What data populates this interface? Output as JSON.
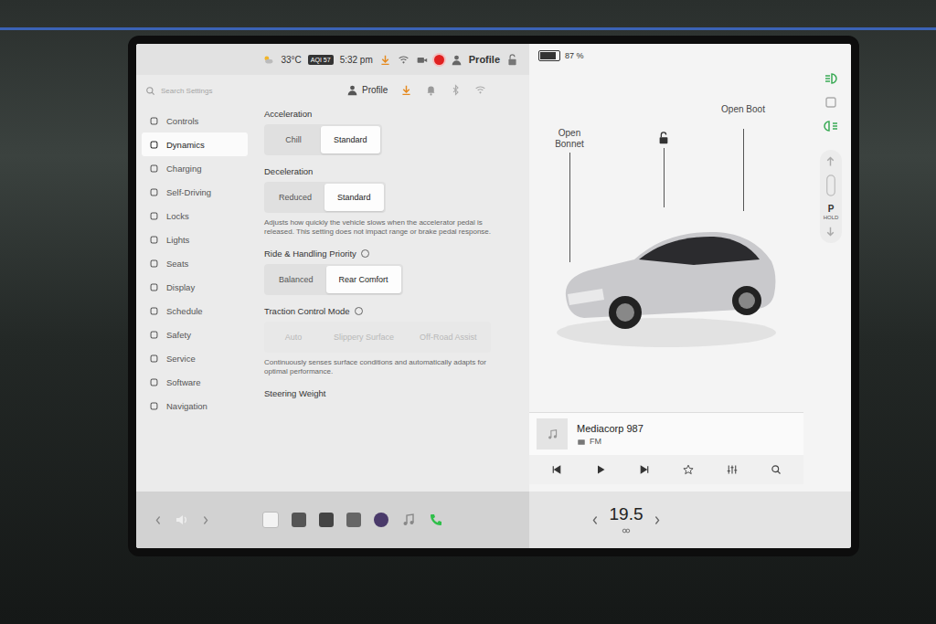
{
  "status_bar": {
    "temperature": "33°C",
    "aqi": "AQI 57",
    "time": "5:32 pm",
    "profile": "Profile",
    "recording": true,
    "battery": "87 %",
    "battery_level": 0.87
  },
  "search": {
    "placeholder": "Search Settings"
  },
  "header": {
    "profile": "Profile"
  },
  "sidebar": {
    "items": [
      {
        "label": "Controls",
        "selected": false
      },
      {
        "label": "Dynamics",
        "selected": true
      },
      {
        "label": "Charging",
        "selected": false
      },
      {
        "label": "Self-Driving",
        "selected": false
      },
      {
        "label": "Locks",
        "selected": false
      },
      {
        "label": "Lights",
        "selected": false
      },
      {
        "label": "Seats",
        "selected": false
      },
      {
        "label": "Display",
        "selected": false
      },
      {
        "label": "Schedule",
        "selected": false
      },
      {
        "label": "Safety",
        "selected": false
      },
      {
        "label": "Service",
        "selected": false
      },
      {
        "label": "Software",
        "selected": false
      },
      {
        "label": "Navigation",
        "selected": false
      }
    ]
  },
  "settings": [
    {
      "kind": "segmented",
      "title": "Acceleration",
      "info": false,
      "disabled": false,
      "description": "",
      "options": [
        {
          "label": "Chill",
          "selected": false
        },
        {
          "label": "Standard",
          "selected": true
        }
      ]
    },
    {
      "kind": "segmented",
      "title": "Deceleration",
      "info": false,
      "disabled": false,
      "description": "Adjusts how quickly the vehicle slows when the accelerator pedal is released. This setting does not impact range or brake pedal response.",
      "options": [
        {
          "label": "Reduced",
          "selected": false
        },
        {
          "label": "Standard",
          "selected": true
        }
      ]
    },
    {
      "kind": "segmented",
      "title": "Ride & Handling Priority",
      "info": true,
      "disabled": false,
      "description": "",
      "options": [
        {
          "label": "Balanced",
          "selected": false
        },
        {
          "label": "Rear Comfort",
          "selected": true
        }
      ]
    },
    {
      "kind": "segmented",
      "title": "Traction Control Mode",
      "info": true,
      "disabled": true,
      "description": "Continuously senses surface conditions and automatically adapts for optimal performance.",
      "options": [
        {
          "label": "Auto",
          "selected": false
        },
        {
          "label": "Slippery Surface",
          "selected": false
        },
        {
          "label": "Off-Road Assist",
          "selected": false
        }
      ]
    },
    {
      "kind": "heading",
      "title": "Steering Weight",
      "info": false,
      "disabled": false,
      "description": "",
      "options": []
    }
  ],
  "car": {
    "bonnet": "Open Bonnet",
    "boot": "Open Boot",
    "locked": false
  },
  "gear": {
    "selected": "P",
    "hold": "HOLD"
  },
  "media": {
    "station": "Mediacorp 987",
    "band": "FM",
    "playing": false
  },
  "climate": {
    "temperature": "19.5"
  }
}
